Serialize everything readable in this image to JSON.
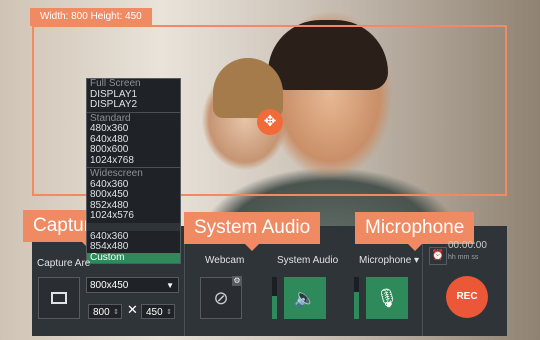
{
  "capture_frame": {
    "dimension_label": "Width: 800  Height: 450"
  },
  "callouts": {
    "capture_area": "Capture Area",
    "system_audio": "System Audio",
    "microphone": "Microphone"
  },
  "dropdown": [
    {
      "text": "Full Screen",
      "kind": "head"
    },
    {
      "text": "DISPLAY1"
    },
    {
      "text": "DISPLAY2"
    },
    {
      "kind": "sep"
    },
    {
      "text": "Standard",
      "kind": "head"
    },
    {
      "text": "480x360"
    },
    {
      "text": "640x480"
    },
    {
      "text": "800x600"
    },
    {
      "text": "1024x768"
    },
    {
      "kind": "sep"
    },
    {
      "text": "Widescreen",
      "kind": "head"
    },
    {
      "text": "640x360"
    },
    {
      "text": "800x450"
    },
    {
      "text": "852x480"
    },
    {
      "text": "1024x576"
    },
    {
      "kind": "gap"
    },
    {
      "text": "640x360"
    },
    {
      "text": "854x480"
    },
    {
      "text": "Custom",
      "kind": "selected"
    }
  ],
  "controls": {
    "capture_area_label": "Capture Are",
    "area_value": "800x450",
    "width_value": "800",
    "height_value": "450",
    "times_symbol": "✕",
    "webcam_label": "Webcam",
    "system_audio_label": "System Audio",
    "microphone_label": "Microphone ▾",
    "rec_label": "REC",
    "timer": "00:00:00",
    "timer_sub": "hh    mm    ss"
  },
  "levels": {
    "system_audio": 0.55,
    "microphone": 0.65
  },
  "colors": {
    "accent": "#f08a62",
    "active_toggle": "#2e8a5a",
    "rec": "#ec5738"
  },
  "icons": [
    "move-icon",
    "capture-area-icon",
    "webcam-off-icon",
    "gear-icon",
    "speaker-icon",
    "microphone-icon",
    "alarm-icon"
  ]
}
